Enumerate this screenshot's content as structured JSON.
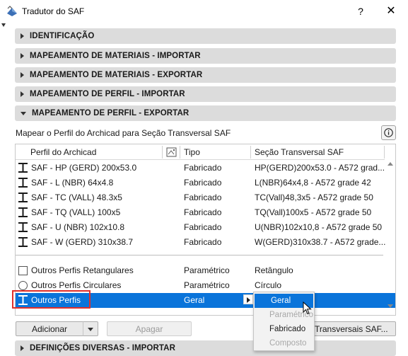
{
  "window": {
    "title": "Tradutor do SAF",
    "help_label": "?",
    "close_label": "✕"
  },
  "sections": [
    {
      "label": "IDENTIFICAÇÃO",
      "expanded": false
    },
    {
      "label": "MAPEAMENTO DE MATERIAIS - IMPORTAR",
      "expanded": false
    },
    {
      "label": "MAPEAMENTO DE MATERIAIS - EXPORTAR",
      "expanded": false
    },
    {
      "label": "MAPEAMENTO DE PERFIL - IMPORTAR",
      "expanded": false
    },
    {
      "label": "MAPEAMENTO DE PERFIL - EXPORTAR",
      "expanded": true
    }
  ],
  "export_panel": {
    "description": "Mapear o Perfil do Archicad para Seção Transversal SAF",
    "columns": {
      "profile": "Perfil do Archicad",
      "type": "Tipo",
      "section": "Seção Transversal SAF"
    },
    "rows": [
      {
        "profile": "SAF - HP (GERD) 200x53.0",
        "type": "Fabricado",
        "section": "HP(GERD)200x53.0 - A572 grad..."
      },
      {
        "profile": "SAF - L (NBR) 64x4.8",
        "type": "Fabricado",
        "section": "L(NBR)64x4,8 - A572 grade 42"
      },
      {
        "profile": "SAF - TC (VALL) 48.3x5",
        "type": "Fabricado",
        "section": "TC(Vall)48,3x5 - A572 grade 50"
      },
      {
        "profile": "SAF - TQ (VALL) 100x5",
        "type": "Fabricado",
        "section": "TQ(Vall)100x5 - A572 grade 50"
      },
      {
        "profile": "SAF - U (NBR) 102x10.8",
        "type": "Fabricado",
        "section": "U(NBR)102x10,8 - A572 grade 50"
      },
      {
        "profile": "SAF - W (GERD) 310x38.7",
        "type": "Fabricado",
        "section": "W(GERD)310x38.7 - A572 grade..."
      }
    ],
    "other_rows": [
      {
        "profile": "Outros Perfis Retangulares",
        "type": "Paramétrico",
        "section": "Retângulo"
      },
      {
        "profile": "Outros Perfis Circulares",
        "type": "Paramétrico",
        "section": "Círculo"
      },
      {
        "profile": "Outros Perfis",
        "type": "Geral",
        "section": ""
      }
    ],
    "buttons": {
      "add": "Adicionar",
      "delete": "Apagar",
      "sections": "Transversais SAF..."
    }
  },
  "type_menu": {
    "items": [
      {
        "label": "Geral",
        "state": "highlighted"
      },
      {
        "label": "Paramétrico",
        "state": "disabled"
      },
      {
        "label": "Fabricado",
        "state": "normal"
      },
      {
        "label": "Composto",
        "state": "disabled"
      }
    ]
  },
  "bottom_section": {
    "label": "DEFINIÇÕES DIVERSAS - IMPORTAR",
    "expanded": false
  },
  "colors": {
    "selection": "#0a74da",
    "section_bg": "#dcdcdc",
    "highlight_frame": "#e0302b"
  }
}
